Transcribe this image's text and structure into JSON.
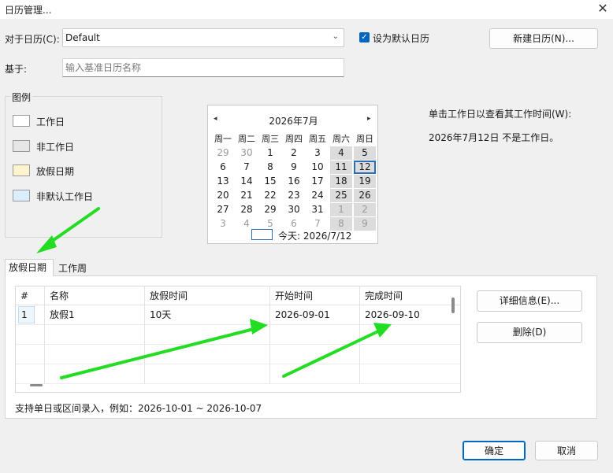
{
  "window": {
    "title": "日历管理...",
    "close_glyph": "✕"
  },
  "form": {
    "calendar_label": "对于日历(C):",
    "calendar_value": "Default",
    "default_checkbox_label": "设为默认日历",
    "default_checked": true,
    "new_calendar_button": "新建日历(N)...",
    "based_on_label": "基于:",
    "based_on_placeholder": "输入基准日历名称"
  },
  "legend": {
    "title": "图例",
    "items": [
      {
        "label": "工作日",
        "color": "#ffffff"
      },
      {
        "label": "非工作日",
        "color": "#e6e6e6"
      },
      {
        "label": "放假日期",
        "color": "#fff3cd"
      },
      {
        "label": "非默认工作日",
        "color": "#dbeefc"
      }
    ]
  },
  "calendar": {
    "prev_glyph": "◂",
    "next_glyph": "▸",
    "month_title": "2026年7月",
    "weekdays": [
      "周一",
      "周二",
      "周三",
      "周四",
      "周五",
      "周六",
      "周日"
    ],
    "weeks": [
      [
        "29",
        "30",
        "1",
        "2",
        "3",
        "4",
        "5"
      ],
      [
        "6",
        "7",
        "8",
        "9",
        "10",
        "11",
        "12"
      ],
      [
        "13",
        "14",
        "15",
        "16",
        "17",
        "18",
        "19"
      ],
      [
        "20",
        "21",
        "22",
        "23",
        "24",
        "25",
        "26"
      ],
      [
        "27",
        "28",
        "29",
        "30",
        "31",
        "1",
        "2"
      ],
      [
        "3",
        "4",
        "5",
        "6",
        "7",
        "8",
        "9"
      ]
    ],
    "today_label": "今天: 2026/7/12"
  },
  "info": {
    "hint": "单击工作日以查看其工作时间(W):",
    "status": "2026年7月12日 不是工作日。"
  },
  "tabs": [
    {
      "label": "放假日期",
      "active": true
    },
    {
      "label": "工作周",
      "active": false
    }
  ],
  "table": {
    "headers": [
      "#",
      "名称",
      "放假时间",
      "开始时间",
      "完成时间"
    ],
    "rows": [
      [
        "1",
        "放假1",
        "10天",
        "2026-09-01",
        "2026-09-10"
      ]
    ]
  },
  "side_buttons": {
    "details": "详细信息(E)...",
    "delete": "删除(D)"
  },
  "footer_hint": "支持单日或区间录入，例如：2026-10-01 ~ 2026-10-07",
  "dialog_buttons": {
    "ok": "确定",
    "cancel": "取消"
  },
  "colors": {
    "accent": "#0067c0",
    "annotation_arrow": "#22dd22"
  }
}
